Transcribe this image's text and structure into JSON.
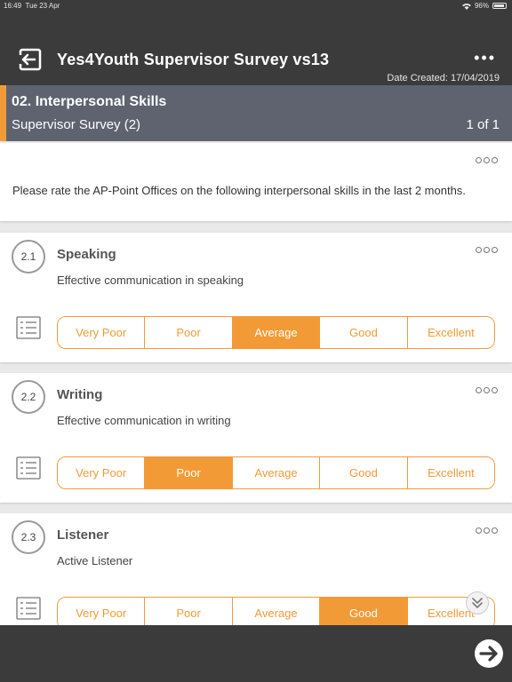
{
  "status_bar": {
    "time": "16:49",
    "date": "Tue 23 Apr",
    "battery": "96%"
  },
  "header": {
    "title": "Yes4Youth Supervisor Survey vs13",
    "more": "•••",
    "date_created": "Date Created: 17/04/2019"
  },
  "section": {
    "title": "02. Interpersonal Skills",
    "subtitle": "Supervisor Survey (2)",
    "page": "1 of 1"
  },
  "intro": "Please rate the AP-Point Offices on the following interpersonal skills in the last 2 months.",
  "questions": [
    {
      "number": "2.1",
      "title": "Speaking",
      "description": "Effective communication in speaking",
      "options": [
        "Very Poor",
        "Poor",
        "Average",
        "Good",
        "Excellent"
      ],
      "selected": "Average"
    },
    {
      "number": "2.2",
      "title": "Writing",
      "description": "Effective communication in writing",
      "options": [
        "Very Poor",
        "Poor",
        "Average",
        "Good",
        "Excellent"
      ],
      "selected": "Poor"
    },
    {
      "number": "2.3",
      "title": "Listener",
      "description": "Active Listener",
      "options": [
        "Very Poor",
        "Poor",
        "Average",
        "Good",
        "Excellent"
      ],
      "selected": "Good"
    }
  ],
  "colors": {
    "accent": "#f29b36",
    "header": "#3b3b3b",
    "section": "#5f6370"
  },
  "icons": {
    "back": "exit-arrow-icon",
    "next": "arrow-right-circle-icon",
    "list": "list-icon",
    "scroll": "chevron-double-down-icon"
  }
}
